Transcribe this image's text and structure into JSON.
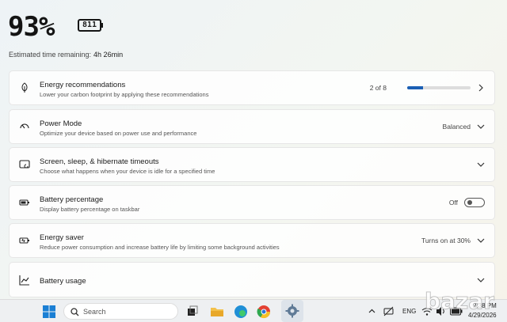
{
  "header": {
    "big_percentage": "93%",
    "battery_badge": "811",
    "estimated_label": "Estimated time remaining:",
    "estimated_value": "4h 26min"
  },
  "cards": {
    "energy_recommendations": {
      "title": "Energy recommendations",
      "desc": "Lower your carbon footprint by applying these recommendations",
      "count": "2 of 8",
      "progress": 0.25,
      "icon": "leaf-icon"
    },
    "power_mode": {
      "title": "Power Mode",
      "desc": "Optimize your device based on power use and performance",
      "value": "Balanced",
      "icon": "gauge-icon"
    },
    "screen_sleep": {
      "title": "Screen, sleep, & hibernate timeouts",
      "desc": "Choose what happens when your device is idle for a specified time",
      "icon": "screen-sleep-icon"
    },
    "battery_percentage": {
      "title": "Battery percentage",
      "desc": "Display battery percentage on taskbar",
      "value": "Off",
      "icon": "battery-icon"
    },
    "energy_saver": {
      "title": "Energy saver",
      "desc": "Reduce power consumption and increase battery life by limiting some background activities",
      "value": "Turns on at 30%",
      "icon": "battery-saver-icon"
    },
    "battery_usage": {
      "title": "Battery usage",
      "icon": "chart-icon"
    }
  },
  "taskbar": {
    "search_placeholder": "Search",
    "language": "ENG",
    "time": "2:38 PM",
    "date": "4/29/2026"
  },
  "watermark": "bazar",
  "colors": {
    "accent": "#1a5fb4",
    "taskbar_bg": "#eef0f2"
  }
}
